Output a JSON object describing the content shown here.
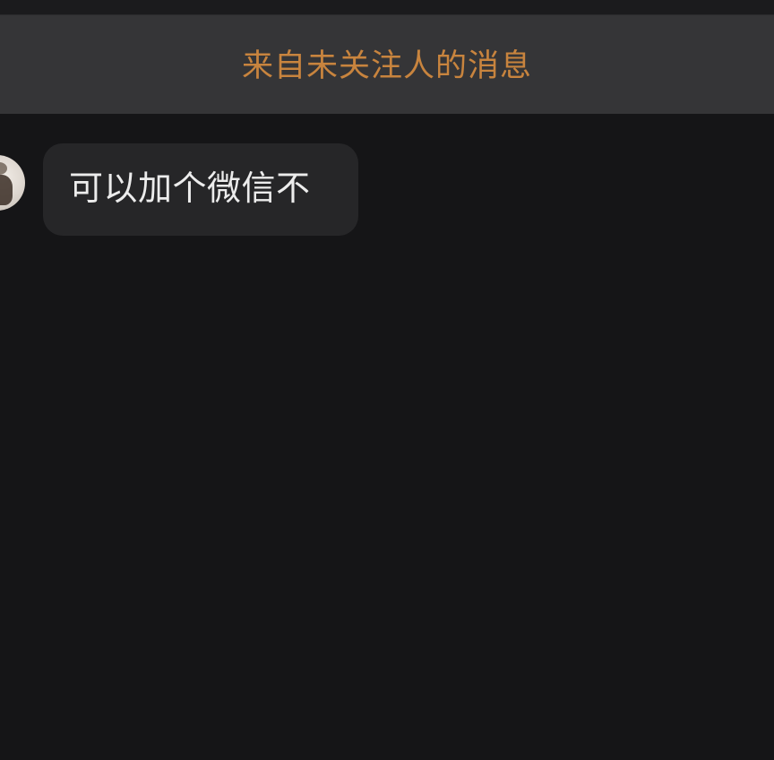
{
  "notice": {
    "text": "来自未关注人的消息"
  },
  "messages": [
    {
      "text": "可以加个微信不"
    }
  ],
  "colors": {
    "background": "#151517",
    "banner": "#353537",
    "banner_text": "#c8843e",
    "bubble": "#262628",
    "bubble_text": "#ececec"
  }
}
